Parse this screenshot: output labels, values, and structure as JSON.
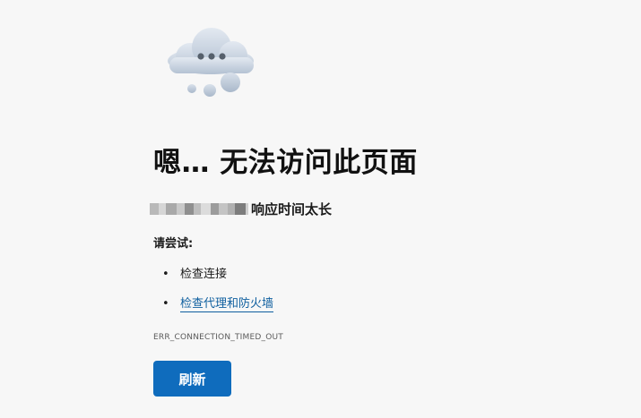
{
  "illustration": {
    "icon": "cloud-with-dots-icon",
    "colors": {
      "cloud": "#c8d3e0",
      "cloud_shadow": "#9fb0c3",
      "dots": "#5b6470"
    }
  },
  "main": {
    "title": "嗯… 无法访问此页面",
    "subtitle_suffix": "响应时间太长",
    "try_heading": "请尝试:",
    "suggestions": [
      {
        "label": "检查连接",
        "is_link": false
      },
      {
        "label": "检查代理和防火墙",
        "is_link": true
      }
    ],
    "error_code": "ERR_CONNECTION_TIMED_OUT",
    "refresh_label": "刷新"
  },
  "theme": {
    "background": "#f7f7f7",
    "accent": "#0f6cbd",
    "link": "#0f5f9f",
    "redacted_blocks": [
      "#b9b9b9",
      "#d6d6d6",
      "#a9a9a9",
      "#c9c9c9",
      "#8f8f8f",
      "#bdbdbd",
      "#dcdcdc",
      "#9c9c9c",
      "#c4c4c4",
      "#b0b0b0",
      "#7d7d7d",
      "#cfcfcf"
    ]
  }
}
